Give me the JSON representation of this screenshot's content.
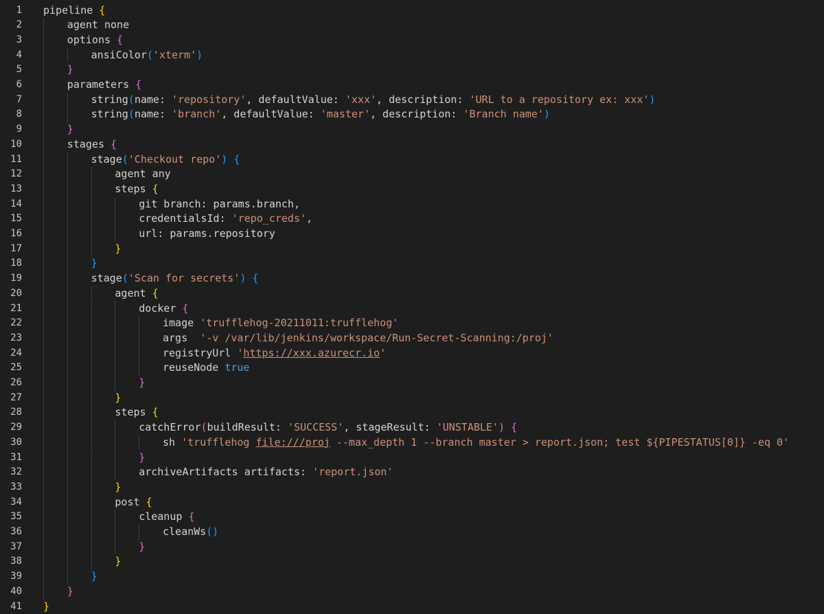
{
  "editor": {
    "colors": {
      "background": "#1e1e1e",
      "text": "#d4d4d4",
      "string": "#ce9178",
      "keyword": "#569cd6",
      "bracket_level_1": "#ffd700",
      "bracket_level_2": "#da70d6",
      "bracket_level_3": "#179fff"
    },
    "lines": [
      {
        "n": "1",
        "indent": 0,
        "tokens": [
          [
            "text",
            "pipeline "
          ],
          [
            "b1",
            "{"
          ]
        ]
      },
      {
        "n": "2",
        "indent": 1,
        "tokens": [
          [
            "text",
            "agent none"
          ]
        ]
      },
      {
        "n": "3",
        "indent": 1,
        "tokens": [
          [
            "text",
            "options "
          ],
          [
            "b2",
            "{"
          ]
        ]
      },
      {
        "n": "4",
        "indent": 2,
        "tokens": [
          [
            "text",
            "ansiColor"
          ],
          [
            "b3",
            "("
          ],
          [
            "str",
            "'xterm'"
          ],
          [
            "b3",
            ")"
          ]
        ]
      },
      {
        "n": "5",
        "indent": 1,
        "tokens": [
          [
            "b2",
            "}"
          ]
        ]
      },
      {
        "n": "6",
        "indent": 1,
        "tokens": [
          [
            "text",
            "parameters "
          ],
          [
            "b2",
            "{"
          ]
        ]
      },
      {
        "n": "7",
        "indent": 2,
        "tokens": [
          [
            "text",
            "string"
          ],
          [
            "b3",
            "("
          ],
          [
            "text",
            "name: "
          ],
          [
            "str",
            "'repository'"
          ],
          [
            "text",
            ", defaultValue: "
          ],
          [
            "str",
            "'xxx'"
          ],
          [
            "text",
            ", description: "
          ],
          [
            "str",
            "'URL to a repository ex: xxx'"
          ],
          [
            "b3",
            ")"
          ]
        ]
      },
      {
        "n": "8",
        "indent": 2,
        "tokens": [
          [
            "text",
            "string"
          ],
          [
            "b3",
            "("
          ],
          [
            "text",
            "name: "
          ],
          [
            "str",
            "'branch'"
          ],
          [
            "text",
            ", defaultValue: "
          ],
          [
            "str",
            "'master'"
          ],
          [
            "text",
            ", description: "
          ],
          [
            "str",
            "'Branch name'"
          ],
          [
            "b3",
            ")"
          ]
        ]
      },
      {
        "n": "9",
        "indent": 1,
        "tokens": [
          [
            "b2",
            "}"
          ]
        ]
      },
      {
        "n": "10",
        "indent": 1,
        "tokens": [
          [
            "text",
            "stages "
          ],
          [
            "b2",
            "{"
          ]
        ]
      },
      {
        "n": "11",
        "indent": 2,
        "tokens": [
          [
            "text",
            "stage"
          ],
          [
            "b3",
            "("
          ],
          [
            "str",
            "'Checkout repo'"
          ],
          [
            "b3",
            ")"
          ],
          [
            "text",
            " "
          ],
          [
            "b3",
            "{"
          ]
        ]
      },
      {
        "n": "12",
        "indent": 3,
        "tokens": [
          [
            "text",
            "agent any"
          ]
        ]
      },
      {
        "n": "13",
        "indent": 3,
        "tokens": [
          [
            "text",
            "steps "
          ],
          [
            "b1",
            "{"
          ]
        ]
      },
      {
        "n": "14",
        "indent": 4,
        "tokens": [
          [
            "text",
            "git branch: params.branch,"
          ]
        ]
      },
      {
        "n": "15",
        "indent": 4,
        "tokens": [
          [
            "text",
            "credentialsId: "
          ],
          [
            "str",
            "'repo_creds'"
          ],
          [
            "text",
            ","
          ]
        ]
      },
      {
        "n": "16",
        "indent": 4,
        "tokens": [
          [
            "text",
            "url: params.repository"
          ]
        ]
      },
      {
        "n": "17",
        "indent": 3,
        "tokens": [
          [
            "b1",
            "}"
          ]
        ]
      },
      {
        "n": "18",
        "indent": 2,
        "tokens": [
          [
            "b3",
            "}"
          ]
        ]
      },
      {
        "n": "19",
        "indent": 2,
        "tokens": [
          [
            "text",
            "stage"
          ],
          [
            "b3",
            "("
          ],
          [
            "str",
            "'Scan for secrets'"
          ],
          [
            "b3",
            ")"
          ],
          [
            "text",
            " "
          ],
          [
            "b3",
            "{"
          ]
        ]
      },
      {
        "n": "20",
        "indent": 3,
        "tokens": [
          [
            "text",
            "agent "
          ],
          [
            "b1",
            "{"
          ]
        ]
      },
      {
        "n": "21",
        "indent": 4,
        "tokens": [
          [
            "text",
            "docker "
          ],
          [
            "b2",
            "{"
          ]
        ]
      },
      {
        "n": "22",
        "indent": 5,
        "tokens": [
          [
            "text",
            "image "
          ],
          [
            "str",
            "'trufflehog-20211011:trufflehog'"
          ]
        ]
      },
      {
        "n": "23",
        "indent": 5,
        "tokens": [
          [
            "text",
            "args  "
          ],
          [
            "str",
            "'-v /var/lib/jenkins/workspace/Run-Secret-Scanning:/proj'"
          ]
        ]
      },
      {
        "n": "24",
        "indent": 5,
        "tokens": [
          [
            "text",
            "registryUrl "
          ],
          [
            "str",
            "'"
          ],
          [
            "url",
            "https://xxx.azurecr.io"
          ],
          [
            "str",
            "'"
          ]
        ]
      },
      {
        "n": "25",
        "indent": 5,
        "tokens": [
          [
            "text",
            "reuseNode "
          ],
          [
            "kw",
            "true"
          ]
        ]
      },
      {
        "n": "26",
        "indent": 4,
        "tokens": [
          [
            "b2",
            "}"
          ]
        ]
      },
      {
        "n": "27",
        "indent": 3,
        "tokens": [
          [
            "b1",
            "}"
          ]
        ]
      },
      {
        "n": "28",
        "indent": 3,
        "tokens": [
          [
            "text",
            "steps "
          ],
          [
            "b1",
            "{"
          ]
        ]
      },
      {
        "n": "29",
        "indent": 4,
        "tokens": [
          [
            "text",
            "catchError"
          ],
          [
            "b2",
            "("
          ],
          [
            "text",
            "buildResult: "
          ],
          [
            "str",
            "'SUCCESS'"
          ],
          [
            "text",
            ", stageResult: "
          ],
          [
            "str",
            "'UNSTABLE'"
          ],
          [
            "b2",
            ")"
          ],
          [
            "text",
            " "
          ],
          [
            "b2",
            "{"
          ]
        ]
      },
      {
        "n": "30",
        "indent": 5,
        "tokens": [
          [
            "text",
            "sh "
          ],
          [
            "str",
            "'trufflehog "
          ],
          [
            "url",
            "file:///proj"
          ],
          [
            "str",
            " --max_depth 1 --branch master > report.json; test ${PIPESTATUS[0]} -eq 0'"
          ]
        ]
      },
      {
        "n": "31",
        "indent": 4,
        "tokens": [
          [
            "b2",
            "}"
          ]
        ]
      },
      {
        "n": "32",
        "indent": 4,
        "tokens": [
          [
            "text",
            "archiveArtifacts artifacts: "
          ],
          [
            "str",
            "'report.json'"
          ]
        ]
      },
      {
        "n": "33",
        "indent": 3,
        "tokens": [
          [
            "b1",
            "}"
          ]
        ]
      },
      {
        "n": "34",
        "indent": 3,
        "tokens": [
          [
            "text",
            "post "
          ],
          [
            "b1",
            "{"
          ]
        ]
      },
      {
        "n": "35",
        "indent": 4,
        "tokens": [
          [
            "text",
            "cleanup "
          ],
          [
            "b2",
            "{"
          ]
        ]
      },
      {
        "n": "36",
        "indent": 5,
        "tokens": [
          [
            "text",
            "cleanWs"
          ],
          [
            "b3",
            "("
          ],
          [
            "b3",
            ")"
          ]
        ]
      },
      {
        "n": "37",
        "indent": 4,
        "tokens": [
          [
            "b2",
            "}"
          ]
        ]
      },
      {
        "n": "38",
        "indent": 3,
        "tokens": [
          [
            "b1",
            "}"
          ]
        ]
      },
      {
        "n": "39",
        "indent": 2,
        "tokens": [
          [
            "b3",
            "}"
          ]
        ]
      },
      {
        "n": "40",
        "indent": 1,
        "tokens": [
          [
            "b2",
            "}"
          ]
        ]
      },
      {
        "n": "41",
        "indent": 0,
        "tokens": [
          [
            "b1",
            "}"
          ]
        ]
      }
    ]
  }
}
